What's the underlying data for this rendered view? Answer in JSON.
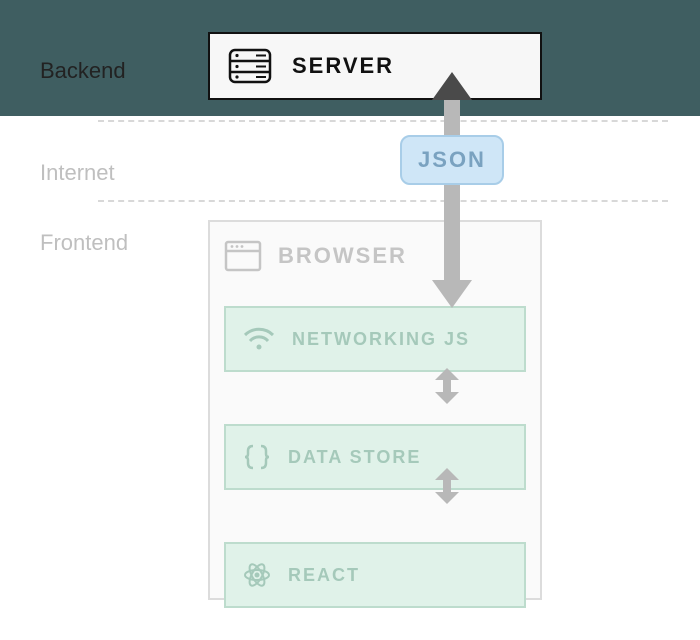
{
  "sections": {
    "backend": "Backend",
    "internet": "Internet",
    "frontend": "Frontend"
  },
  "server": {
    "label": "SERVER"
  },
  "json": {
    "label": "JSON"
  },
  "browser": {
    "label": "BROWSER"
  },
  "stack": {
    "networking": "NETWORKING JS",
    "datastore": "DATA STORE",
    "react": "REACT"
  },
  "colors": {
    "backend_band": "#3f5e61",
    "mint_fill": "#e0f2e9",
    "mint_border": "#bddccd",
    "json_fill": "#cfe6f7",
    "arrow": "#b8b8b8"
  }
}
